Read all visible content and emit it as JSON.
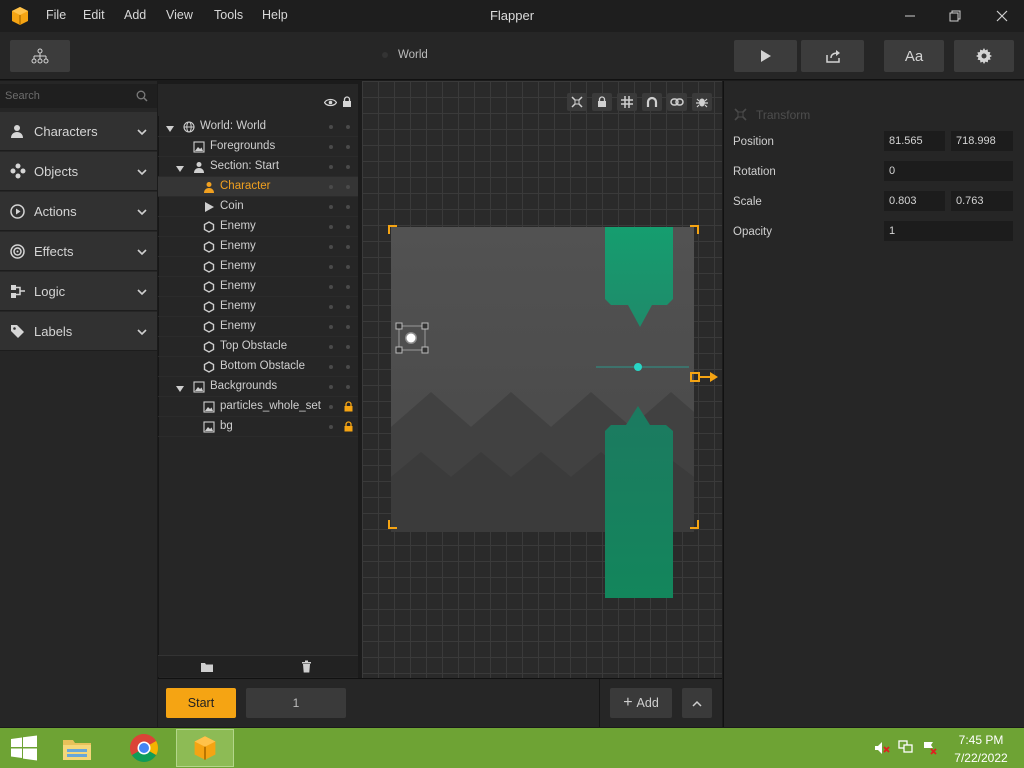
{
  "window": {
    "title": "Flapper",
    "menu": [
      "File",
      "Edit",
      "Add",
      "View",
      "Tools",
      "Help"
    ],
    "controls": [
      "minimize-icon",
      "restore-icon",
      "close-icon"
    ]
  },
  "toolbar": {
    "breadcrumb": "World",
    "left_button_icon": "hierarchy-icon",
    "buttons": [
      "play-icon",
      "share-icon",
      "Aa",
      "gear-icon"
    ]
  },
  "sidebar": {
    "search_placeholder": "Search",
    "categories": [
      {
        "label": "Characters",
        "icon": "person-icon"
      },
      {
        "label": "Objects",
        "icon": "objects-icon"
      },
      {
        "label": "Actions",
        "icon": "play-circle-icon"
      },
      {
        "label": "Effects",
        "icon": "spiral-icon"
      },
      {
        "label": "Logic",
        "icon": "logic-icon"
      },
      {
        "label": "Labels",
        "icon": "tag-icon"
      }
    ]
  },
  "tree": {
    "header_icons": [
      "eye-icon",
      "lock-icon"
    ],
    "rows": [
      {
        "label": "World: World",
        "icon": "globe-icon",
        "indent": 0,
        "expanded": true
      },
      {
        "label": "Foregrounds",
        "icon": "image-icon",
        "indent": 1
      },
      {
        "label": "Section: Start",
        "icon": "person-icon",
        "indent": 1,
        "expanded": true
      },
      {
        "label": "Character",
        "icon": "person-icon",
        "indent": 2,
        "selected": true
      },
      {
        "label": "Coin",
        "icon": "triangle-icon",
        "indent": 2
      },
      {
        "label": "Enemy",
        "icon": "hexagon-icon",
        "indent": 2
      },
      {
        "label": "Enemy",
        "icon": "hexagon-icon",
        "indent": 2
      },
      {
        "label": "Enemy",
        "icon": "hexagon-icon",
        "indent": 2
      },
      {
        "label": "Enemy",
        "icon": "hexagon-icon",
        "indent": 2
      },
      {
        "label": "Enemy",
        "icon": "hexagon-icon",
        "indent": 2
      },
      {
        "label": "Enemy",
        "icon": "hexagon-icon",
        "indent": 2
      },
      {
        "label": "Top Obstacle",
        "icon": "hexagon-icon",
        "indent": 2
      },
      {
        "label": "Bottom Obstacle",
        "icon": "hexagon-icon",
        "indent": 2
      },
      {
        "label": "Backgrounds",
        "icon": "image-icon",
        "indent": 1,
        "expanded": true
      },
      {
        "label": "particles_whole_set",
        "icon": "image-icon",
        "indent": 2,
        "locked": true
      },
      {
        "label": "bg",
        "icon": "image-icon",
        "indent": 2,
        "locked": true
      }
    ],
    "footer_icons": [
      "folder-icon",
      "trash-icon"
    ]
  },
  "canvas": {
    "tools": [
      "group-icon",
      "lock-icon",
      "grid-icon",
      "magnet-icon",
      "link-icon",
      "bug-icon"
    ]
  },
  "inspector": {
    "section_title": "Transform",
    "position": {
      "label": "Position",
      "x": "81.565",
      "y": "718.998"
    },
    "rotation": {
      "label": "Rotation",
      "value": "0"
    },
    "scale": {
      "label": "Scale",
      "x": "0.803",
      "y": "0.763"
    },
    "opacity": {
      "label": "Opacity",
      "value": "1"
    }
  },
  "bottom": {
    "start_label": "Start",
    "section_value": "1",
    "add_label": "Add"
  },
  "taskbar": {
    "time": "7:45 PM",
    "date": "7/22/2022"
  },
  "colors": {
    "accent": "#f5a413",
    "obstacle": "#1f9e75",
    "taskbar": "#6ea334"
  }
}
